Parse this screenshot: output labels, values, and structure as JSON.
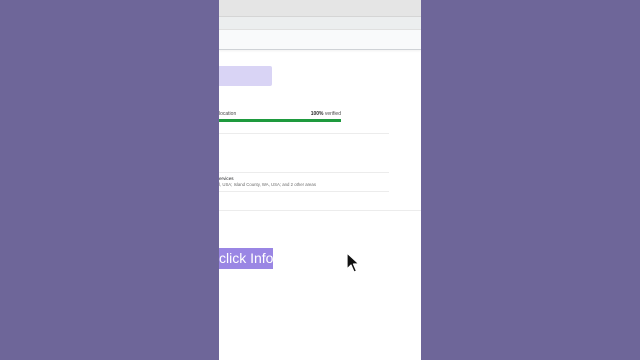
{
  "verification": {
    "label": "location",
    "percent_text": "100%",
    "suffix_text": "verified",
    "progress_fraction": 1.0,
    "bar_color": "#1e9a3e"
  },
  "services": {
    "title": "ervices",
    "subtitle": "l, USA; Island County, WA, USA; and 2 other areas"
  },
  "overlay": {
    "label": "Click Info",
    "label_visible": "click Info",
    "background": "#9a86e4"
  },
  "colors": {
    "backdrop": "#6e6699",
    "accent_lavender": "#d9d4f5"
  },
  "icons": {
    "cursor": "mouse-pointer-arrow"
  }
}
